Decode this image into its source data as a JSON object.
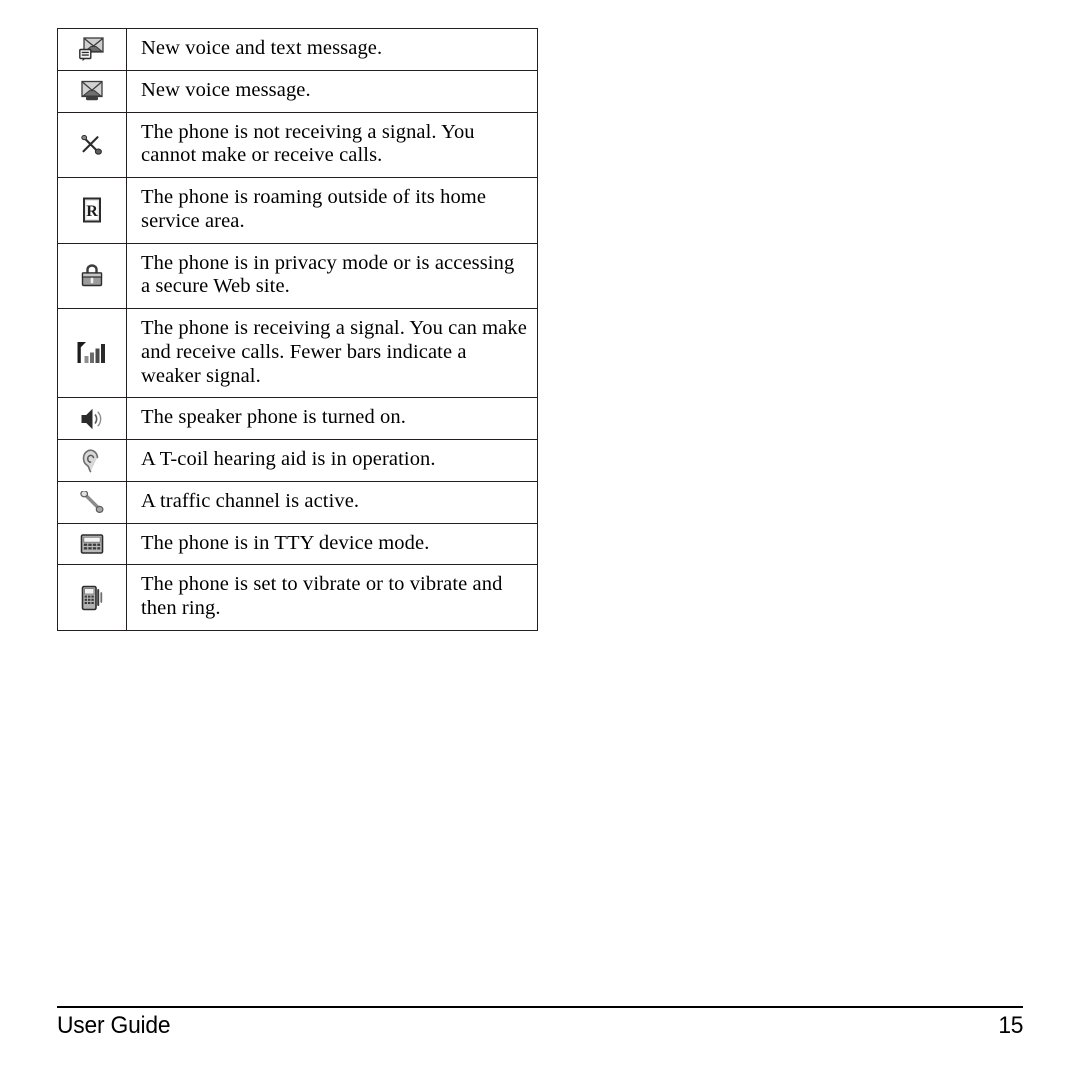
{
  "page": {
    "background": "#ffffff",
    "text_color": "#000000"
  },
  "table": {
    "columns": [
      "icon",
      "description"
    ],
    "rows": [
      {
        "icon": "new-voice-and-text-message-icon",
        "description": "New voice and text message."
      },
      {
        "icon": "new-voice-message-icon",
        "description": "New voice message."
      },
      {
        "icon": "no-signal-icon",
        "description": "The phone is not receiving a signal. You cannot make or receive calls."
      },
      {
        "icon": "roaming-icon",
        "description": "The phone is roaming outside of its home service area."
      },
      {
        "icon": "privacy-lock-icon",
        "description": "The phone is in privacy mode or is accessing a secure Web site."
      },
      {
        "icon": "signal-strength-icon",
        "description": "The phone is receiving a signal. You can make and receive calls. Fewer bars indicate a weaker signal."
      },
      {
        "icon": "speaker-phone-icon",
        "description": "The speaker phone is turned on."
      },
      {
        "icon": "t-coil-hearing-aid-icon",
        "description": "A T-coil hearing aid is in operation."
      },
      {
        "icon": "traffic-channel-handset-icon",
        "description": "A traffic channel is active."
      },
      {
        "icon": "tty-device-icon",
        "description": "The phone is in TTY device mode."
      },
      {
        "icon": "vibrate-icon",
        "description": "The phone is set to vibrate or to vibrate and then ring."
      }
    ]
  },
  "footer": {
    "left_label": "User Guide",
    "page_number": "15"
  }
}
